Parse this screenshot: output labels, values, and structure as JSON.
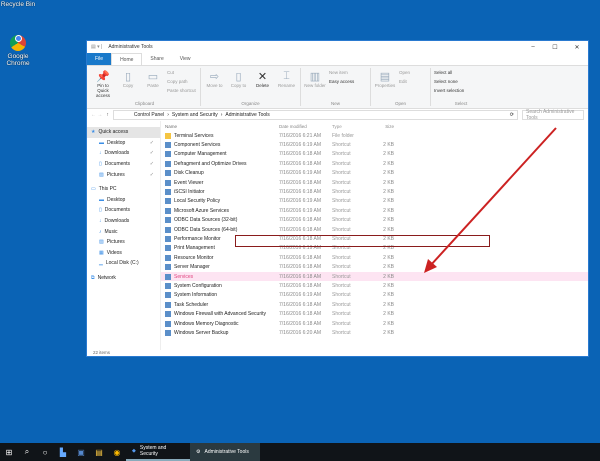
{
  "desktop": {
    "icons": [
      {
        "label": "Recycle Bin"
      },
      {
        "label": "Google Chrome"
      }
    ]
  },
  "window": {
    "title": "Administrative Tools",
    "controls": [
      "–",
      "☐",
      "✕"
    ]
  },
  "tabs": [
    "File",
    "Home",
    "Share",
    "View"
  ],
  "ribbon": {
    "clipboard": {
      "label": "Clipboard",
      "pin": "Pin to Quick access",
      "copy": "Copy",
      "paste": "Paste",
      "cut": "Cut",
      "copy_path": "Copy path",
      "paste_shortcut": "Paste shortcut"
    },
    "organize": {
      "label": "Organize",
      "move_to": "Move to",
      "copy_to": "Copy to",
      "delete": "Delete",
      "rename": "Rename"
    },
    "new": {
      "label": "New",
      "new_folder": "New folder",
      "new_item": "New item",
      "easy_access": "Easy access"
    },
    "open": {
      "label": "Open",
      "properties": "Properties",
      "open": "Open",
      "edit": "Edit"
    },
    "select": {
      "label": "Select",
      "select_all": "Select all",
      "select_none": "Select none",
      "invert": "Invert selection"
    }
  },
  "address": {
    "crumbs": [
      "Control Panel",
      "System and Security",
      "Administrative Tools"
    ],
    "search_placeholder": "Search Administrative Tools"
  },
  "sidebar": [
    {
      "label": "Quick access",
      "sel": true
    },
    {
      "label": "Desktop"
    },
    {
      "label": "Downloads"
    },
    {
      "label": "Documents"
    },
    {
      "label": "Pictures"
    },
    {
      "label": "This PC"
    },
    {
      "label": "Desktop"
    },
    {
      "label": "Documents"
    },
    {
      "label": "Downloads"
    },
    {
      "label": "Music"
    },
    {
      "label": "Pictures"
    },
    {
      "label": "Videos"
    },
    {
      "label": "Local Disk (C:)"
    },
    {
      "label": "Network"
    }
  ],
  "columns": [
    "Name",
    "Date modified",
    "Type",
    "Size"
  ],
  "files": [
    [
      "Terminal Services",
      "7/16/2016 6:21 AM",
      "File folder",
      ""
    ],
    [
      "Component Services",
      "7/16/2016 6:19 AM",
      "Shortcut",
      "2 KB"
    ],
    [
      "Computer Management",
      "7/16/2016 6:18 AM",
      "Shortcut",
      "2 KB"
    ],
    [
      "Defragment and Optimize Drives",
      "7/16/2016 6:18 AM",
      "Shortcut",
      "2 KB"
    ],
    [
      "Disk Cleanup",
      "7/16/2016 6:19 AM",
      "Shortcut",
      "2 KB"
    ],
    [
      "Event Viewer",
      "7/16/2016 6:18 AM",
      "Shortcut",
      "2 KB"
    ],
    [
      "iSCSI Initiator",
      "7/16/2016 6:18 AM",
      "Shortcut",
      "2 KB"
    ],
    [
      "Local Security Policy",
      "7/16/2016 6:19 AM",
      "Shortcut",
      "2 KB"
    ],
    [
      "Microsoft Azure Services",
      "7/16/2016 6:19 AM",
      "Shortcut",
      "2 KB"
    ],
    [
      "ODBC Data Sources (32-bit)",
      "7/16/2016 6:18 AM",
      "Shortcut",
      "2 KB"
    ],
    [
      "ODBC Data Sources (64-bit)",
      "7/16/2016 6:18 AM",
      "Shortcut",
      "2 KB"
    ],
    [
      "Performance Monitor",
      "7/16/2016 6:18 AM",
      "Shortcut",
      "2 KB"
    ],
    [
      "Print Management",
      "7/16/2016 6:19 AM",
      "Shortcut",
      "2 KB"
    ],
    [
      "Resource Monitor",
      "7/16/2016 6:18 AM",
      "Shortcut",
      "2 KB"
    ],
    [
      "Server Manager",
      "7/16/2016 6:18 AM",
      "Shortcut",
      "2 KB"
    ],
    [
      "Services",
      "7/16/2016 6:18 AM",
      "Shortcut",
      "2 KB"
    ],
    [
      "System Configuration",
      "7/16/2016 6:18 AM",
      "Shortcut",
      "2 KB"
    ],
    [
      "System Information",
      "7/16/2016 6:19 AM",
      "Shortcut",
      "2 KB"
    ],
    [
      "Task Scheduler",
      "7/16/2016 6:18 AM",
      "Shortcut",
      "2 KB"
    ],
    [
      "Windows Firewall with Advanced Security",
      "7/16/2016 6:18 AM",
      "Shortcut",
      "2 KB"
    ],
    [
      "Windows Memory Diagnostic",
      "7/16/2016 6:18 AM",
      "Shortcut",
      "2 KB"
    ],
    [
      "Windows Server Backup",
      "7/16/2016 6:20 AM",
      "Shortcut",
      "2 KB"
    ]
  ],
  "highlighted": "Services",
  "status": "22 items",
  "taskbar": {
    "tasks": [
      "System and Security",
      "Administrative Tools"
    ]
  },
  "colors": {
    "desktop": "#0a63b5",
    "highlight_box": "#8a1c1c",
    "arrow": "#cc2222",
    "accent": "#1979ca"
  }
}
